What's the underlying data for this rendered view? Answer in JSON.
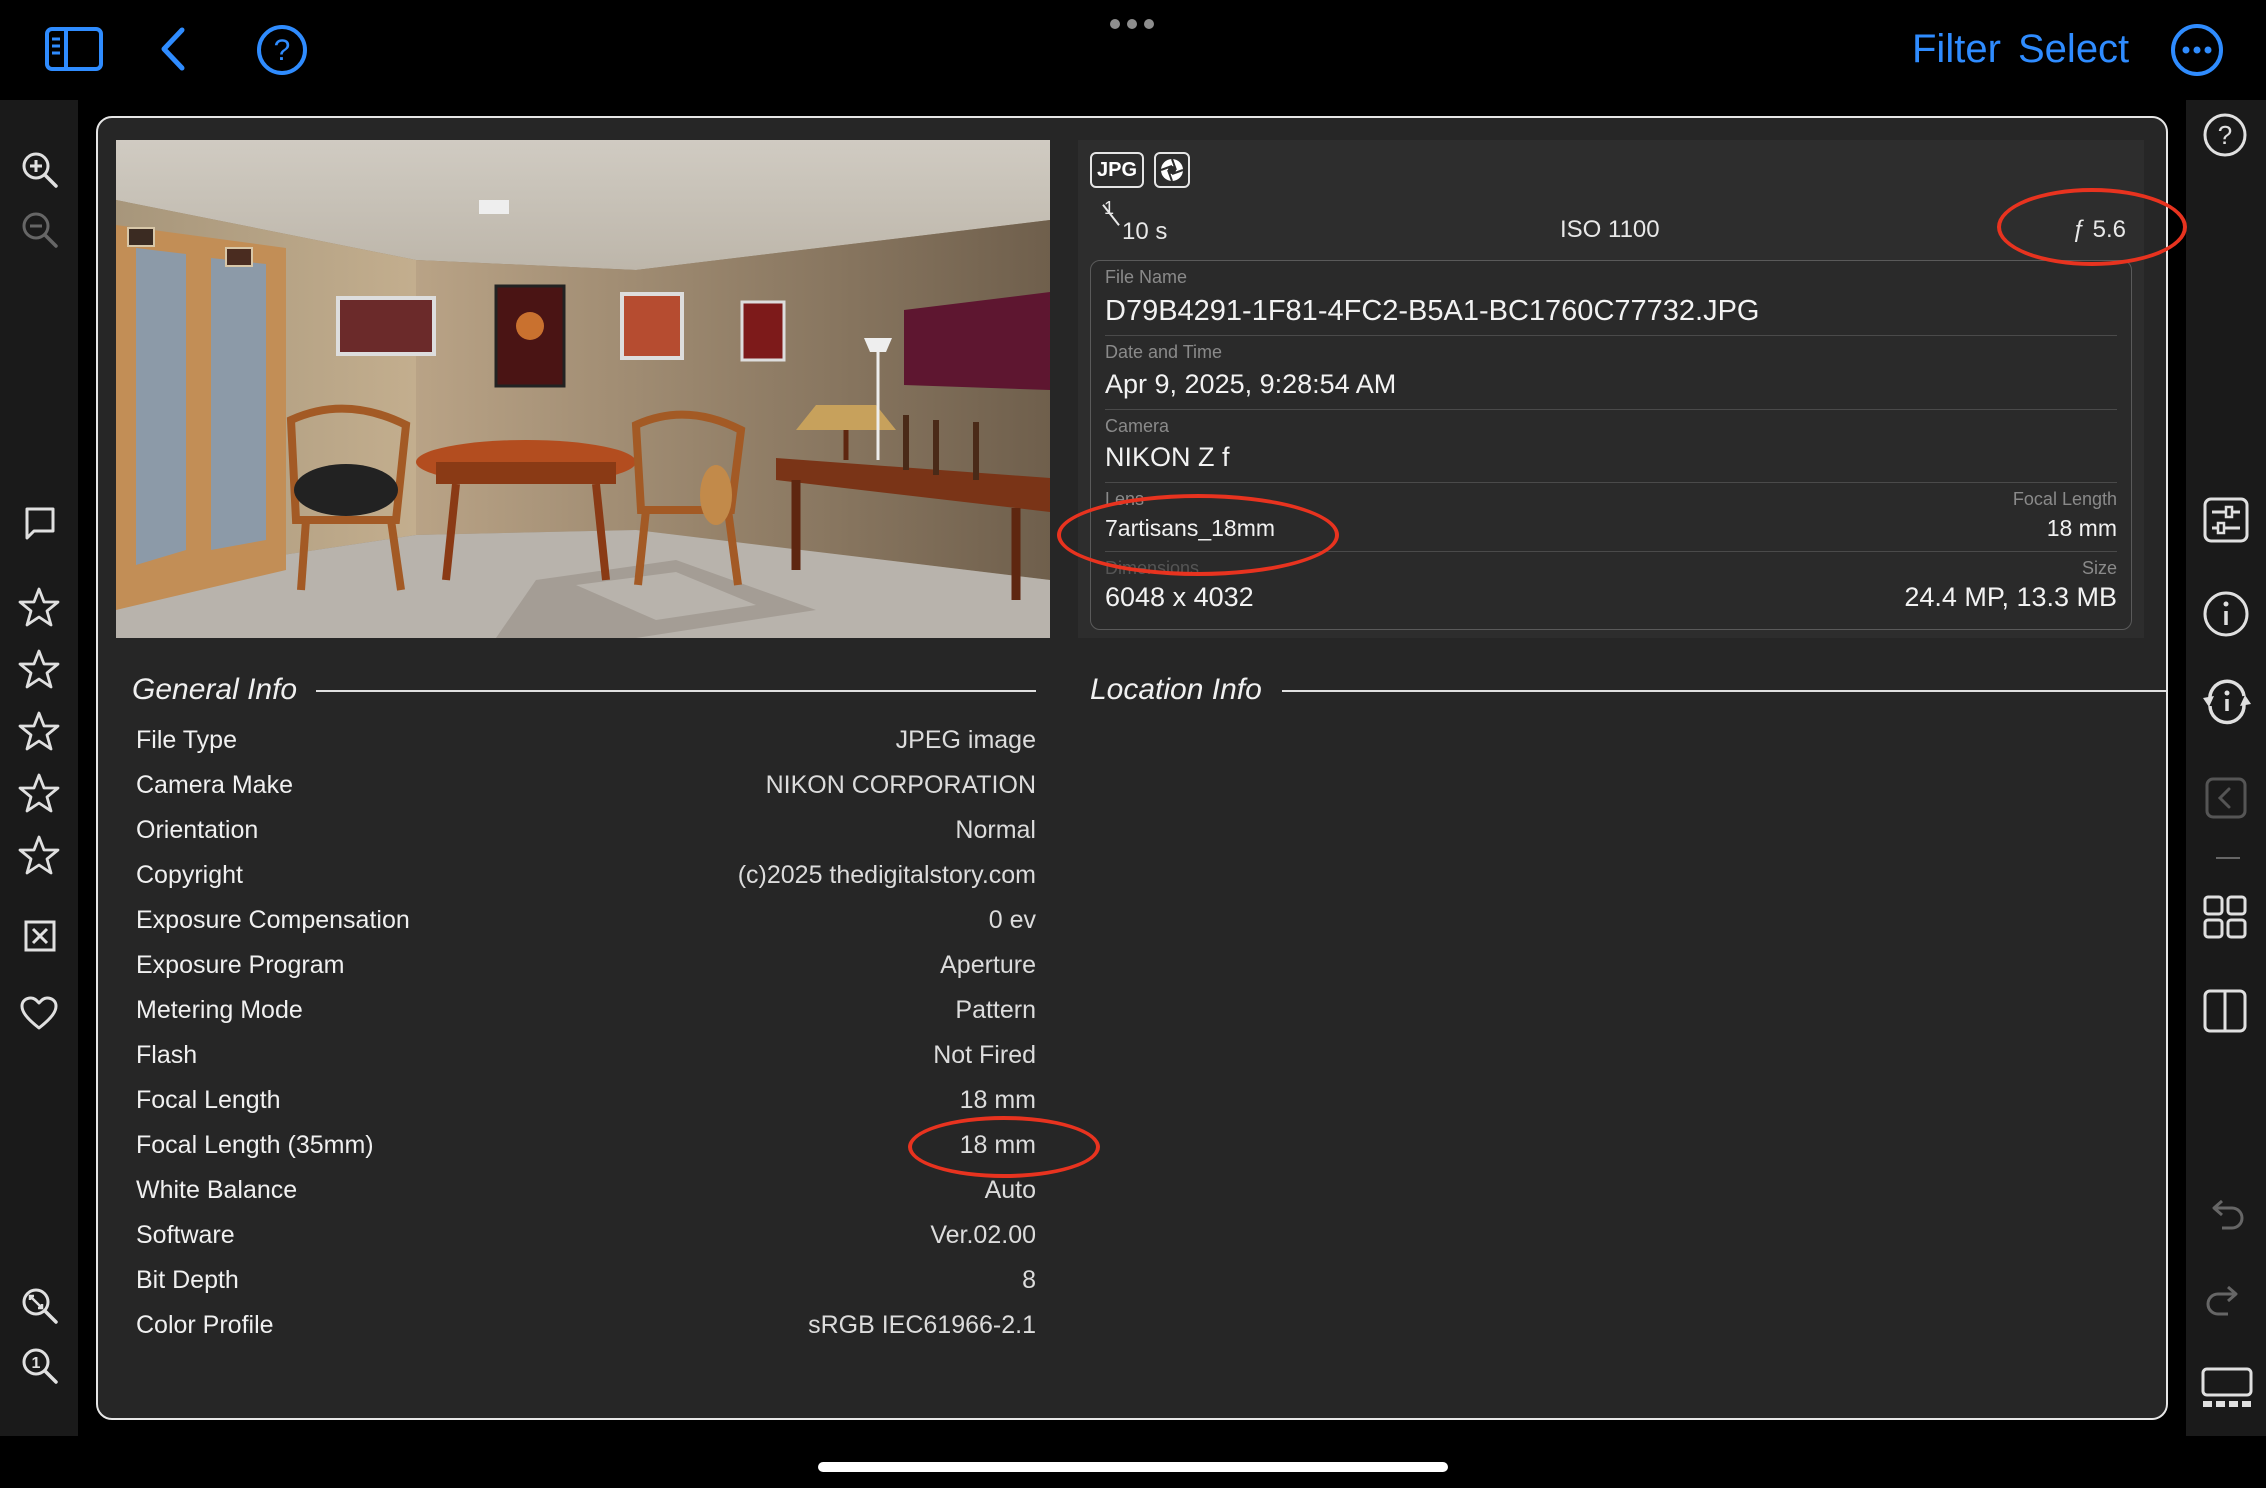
{
  "toolbar": {
    "sidebar_icon": "sidebar-toggle-icon",
    "back_icon": "chevron-left-icon",
    "help_icon": "question-circle-icon",
    "more_dots_icon": "ellipsis-icon",
    "filter_label": "Filter",
    "select_label": "Select",
    "more_icon": "ellipsis-circle-icon",
    "accent_color": "#2F8CFF"
  },
  "left_sidebar": {
    "icons": [
      "zoom-in-icon",
      "zoom-out-icon",
      "comment-icon",
      "star-icon",
      "star-icon",
      "star-icon",
      "star-icon",
      "star-icon",
      "reject-icon",
      "heart-icon",
      "zoom-fit-icon",
      "zoom-actual-icon"
    ],
    "rating_stars": 0
  },
  "right_sidebar": {
    "icons": [
      "help-icon",
      "adjustments-icon",
      "info-icon",
      "metadata-sync-icon",
      "collapse-icon",
      "grid-icon",
      "split-view-icon",
      "undo-icon",
      "redo-icon",
      "filmstrip-icon"
    ]
  },
  "exif": {
    "badges": [
      "JPG",
      "aperture-icon"
    ],
    "shutter_numerator": "1",
    "shutter_denominator": "10 s",
    "iso": "ISO 1100",
    "aperture": "ƒ 5.6",
    "file_name_label": "File Name",
    "file_name": "D79B4291-1F81-4FC2-B5A1-BC1760C77732.JPG",
    "date_label": "Date and Time",
    "date": "Apr 9, 2025, 9:28:54 AM",
    "camera_label": "Camera",
    "camera": "NIKON Z f",
    "lens_label": "Lens",
    "lens": "7artisans_18mm",
    "focal_label": "Focal Length",
    "focal": "18 mm",
    "dimensions_label": "Dimensions",
    "dimensions": "6048 x 4032",
    "size_label": "Size",
    "size": "24.4 MP, 13.3 MB"
  },
  "general_info": {
    "title": "General Info",
    "rows": [
      {
        "label": "File Type",
        "value": "JPEG image"
      },
      {
        "label": "Camera Make",
        "value": "NIKON CORPORATION"
      },
      {
        "label": "Orientation",
        "value": "Normal"
      },
      {
        "label": "Copyright",
        "value": "(c)2025 thedigitalstory.com"
      },
      {
        "label": "Exposure Compensation",
        "value": "0 ev"
      },
      {
        "label": "Exposure Program",
        "value": "Aperture"
      },
      {
        "label": "Metering Mode",
        "value": "Pattern"
      },
      {
        "label": "Flash",
        "value": "Not Fired"
      },
      {
        "label": "Focal Length",
        "value": "18 mm"
      },
      {
        "label": "Focal Length (35mm)",
        "value": "18 mm"
      },
      {
        "label": "White Balance",
        "value": "Auto"
      },
      {
        "label": "Software",
        "value": "Ver.02.00"
      },
      {
        "label": "Bit Depth",
        "value": "8"
      },
      {
        "label": "Color Profile",
        "value": "sRGB IEC61966-2.1"
      }
    ]
  },
  "location_info": {
    "title": "Location Info"
  },
  "annotation_color": "#E8331F"
}
